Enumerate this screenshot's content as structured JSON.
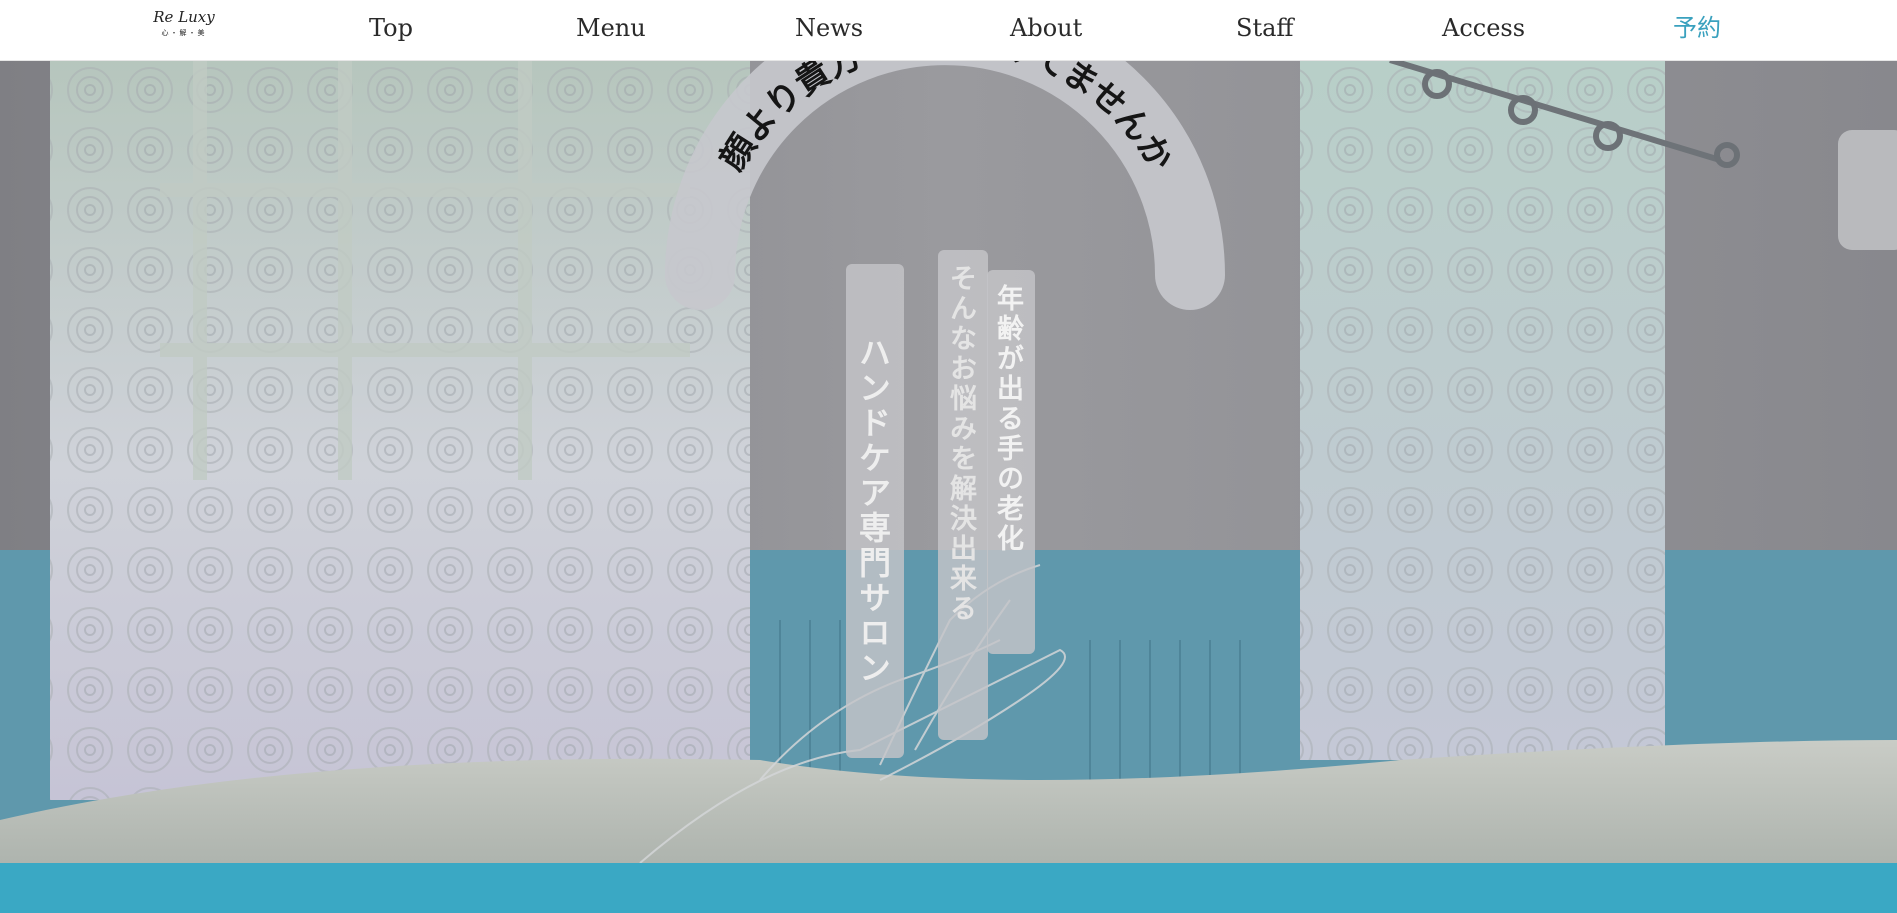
{
  "nav": {
    "logo": {
      "script": "Re Luxy",
      "sub": "心・解・美"
    },
    "items": [
      {
        "label": "Top"
      },
      {
        "label": "Menu"
      },
      {
        "label": "News"
      },
      {
        "label": "About"
      },
      {
        "label": "Staff"
      },
      {
        "label": "Access"
      },
      {
        "label": "予約"
      }
    ],
    "reserve_color": "#3aa1be"
  },
  "hero": {
    "headline": "顔より貴方の手…老けてませんか",
    "vertical_texts": [
      "ハンドケア専門サロン",
      "そんなお悩みを解決出来る",
      "年齢が出る手の老化"
    ]
  },
  "colors": {
    "bottom_band": "#3aa8c4",
    "wall": "#8f8f93",
    "wainscot": "#5f98ac"
  }
}
